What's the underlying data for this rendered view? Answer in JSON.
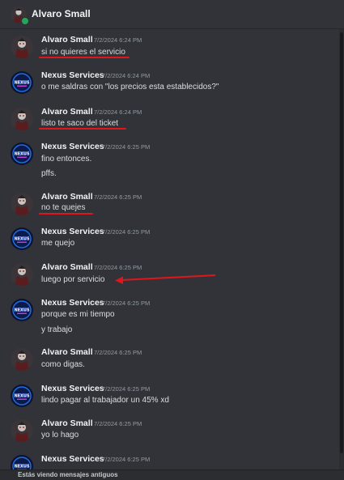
{
  "header": {
    "name": "Alvaro Small",
    "status_color": "#23a55a"
  },
  "users": {
    "alvaro": {
      "name": "Alvaro Small",
      "avatar_icon": "alvaro-avatar-icon"
    },
    "nexus": {
      "name": "Nexus Services",
      "avatar_icon": "nexus-logo-icon"
    }
  },
  "messages": [
    {
      "author": "Alvaro Small",
      "time": "7/2/2024 6:24 PM",
      "lines": [
        "si no quieres el servicio"
      ]
    },
    {
      "author": "Nexus Services",
      "time": "7/2/2024 6:24 PM",
      "lines": [
        "o me saldras con \"los precios esta establecidos?\""
      ]
    },
    {
      "author": "Alvaro Small",
      "time": "7/2/2024 6:24 PM",
      "lines": [
        "listo te saco del ticket"
      ]
    },
    {
      "author": "Nexus Services",
      "time": "7/2/2024 6:25 PM",
      "lines": [
        "fino entonces.",
        "pffs."
      ]
    },
    {
      "author": "Alvaro Small",
      "time": "7/2/2024 6:25 PM",
      "lines": [
        "no te quejes"
      ]
    },
    {
      "author": "Nexus Services",
      "time": "7/2/2024 6:25 PM",
      "lines": [
        "me quejo"
      ]
    },
    {
      "author": "Alvaro Small",
      "time": "7/2/2024 6:25 PM",
      "lines": [
        "luego por servicio"
      ]
    },
    {
      "author": "Nexus Services",
      "time": "7/2/2024 6:25 PM",
      "lines": [
        "porque es mi tiempo",
        "y trabajo"
      ]
    },
    {
      "author": "Alvaro Small",
      "time": "7/2/2024 6:25 PM",
      "lines": [
        "como digas."
      ]
    },
    {
      "author": "Nexus Services",
      "time": "7/2/2024 6:25 PM",
      "lines": [
        "lindo pagar al trabajador un 45% xd"
      ]
    },
    {
      "author": "Alvaro Small",
      "time": "7/2/2024 6:25 PM",
      "lines": [
        "yo lo hago"
      ]
    },
    {
      "author": "Nexus Services",
      "time": "7/2/2024 6:25 PM",
      "lines": []
    }
  ],
  "annotations": {
    "color": "#e0161e"
  },
  "footer": {
    "text": "Estás viendo mensajes antiguos"
  }
}
